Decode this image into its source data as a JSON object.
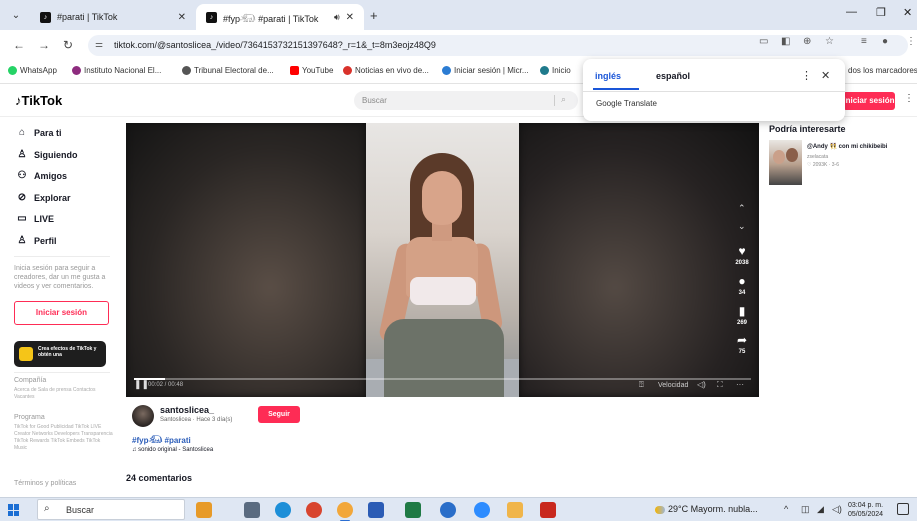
{
  "browser": {
    "tabs": [
      {
        "title": "#parati | TikTok",
        "active": false
      },
      {
        "title": "#fyp𓃰 #parati | TikTok",
        "active": true
      }
    ],
    "url": "tiktok.com/@santoslicea_/video/7364153732151397648?_r=1&_t=8m3eojz48Q9",
    "bookmarks": [
      {
        "label": "WhatsApp",
        "color": "#25d366"
      },
      {
        "label": "Instituto Nacional El...",
        "color": "#8e2c7f"
      },
      {
        "label": "Tribunal Electoral de...",
        "color": "#555555"
      },
      {
        "label": "YouTube",
        "color": "#ff0000"
      },
      {
        "label": "Noticias en vivo de...",
        "color": "#d9322b"
      },
      {
        "label": "Iniciar sesión | Micr...",
        "color": "#2b7cd3"
      },
      {
        "label": "Inicio",
        "color": "#1f7a8c"
      },
      {
        "label": "dos los marcadores",
        "color": ""
      }
    ]
  },
  "translate": {
    "lang_source": "inglés",
    "lang_target": "español",
    "brand": "Google Translate"
  },
  "tiktok": {
    "logo": "TikTok",
    "search_placeholder": "Buscar",
    "login_top": "Iniciar sesión",
    "nav": [
      {
        "label": "Para ti",
        "icon": "home-icon",
        "glyph": "⌂"
      },
      {
        "label": "Siguiendo",
        "icon": "following-icon",
        "glyph": "♙"
      },
      {
        "label": "Amigos",
        "icon": "friends-icon",
        "glyph": "⚇"
      },
      {
        "label": "Explorar",
        "icon": "compass-icon",
        "glyph": "⊘"
      },
      {
        "label": "LIVE",
        "icon": "live-icon",
        "glyph": "▭"
      },
      {
        "label": "Perfil",
        "icon": "profile-icon",
        "glyph": "♙"
      }
    ],
    "login_hint": "Inicia sesión para seguir a creadores, dar un me gusta a videos y ver comentarios.",
    "login_button": "Iniciar sesión",
    "promo": "Crea efectos de TikTok y obtén una",
    "footer": {
      "company_title": "Compañía",
      "company_links": "Acerca de  Sala de prensa  Contactos  Vacantes",
      "program_title": "Programa",
      "program_links": "TikTok for Good  Publicidad  TikTok LIVE Creator Networks  Developers  Transparencia  TikTok Rewards  TikTok Embeds  TikTok Music",
      "terms_title": "Términos y políticas"
    }
  },
  "video": {
    "progress": 0.05,
    "timecode": "00:02 / 00:48",
    "speed_label": "Velocidad",
    "actions": [
      {
        "name": "like-icon",
        "glyph": "♥",
        "count": "2038"
      },
      {
        "name": "comment-icon",
        "glyph": "●",
        "count": "34"
      },
      {
        "name": "bookmark-icon",
        "glyph": "▮",
        "count": "269"
      },
      {
        "name": "share-icon",
        "glyph": "➦",
        "count": "75"
      }
    ],
    "author": "santoslicea_",
    "author_sub": "Santoslicea · Hace 3 día(s)",
    "follow": "Seguir",
    "hashtags": "#fyp𓃰 #parati",
    "sound": "♫ sonido original - Santoslicea",
    "comments_title": "24 comentarios"
  },
  "recommend": {
    "title": "Podría interesarte",
    "caption": "@Andy 👯 con mi chikibeibi",
    "user": "zselacata",
    "stats": "♡ 2093K · 3-6"
  },
  "taskbar": {
    "search": "Buscar",
    "weather": "29°C  Mayorm. nubla...",
    "time": "03:04 p. m.",
    "date": "05/05/2024"
  }
}
